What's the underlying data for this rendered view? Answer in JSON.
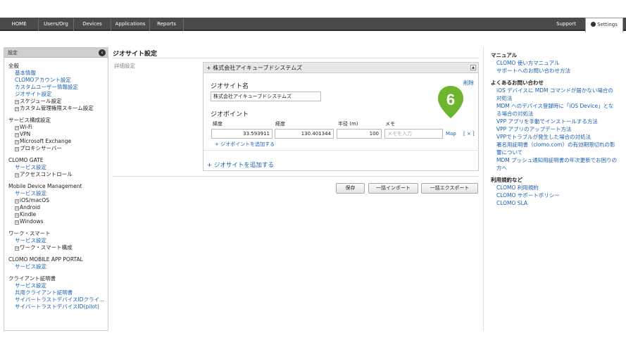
{
  "nav": {
    "items": [
      "HOME",
      "Users/Org",
      "Devices",
      "Applications",
      "Reports"
    ],
    "support": "Support",
    "settings": "Settings"
  },
  "sidebar": {
    "header": "設定",
    "collapse_symbol": "‹",
    "sections": [
      {
        "title": "全般",
        "items": [
          {
            "label": "基本情報",
            "kind": "link"
          },
          {
            "label": "CLOMOアカウント設定",
            "kind": "link"
          },
          {
            "label": "カスタムユーザー情報設定",
            "kind": "link"
          },
          {
            "label": "ジオサイト設定",
            "kind": "link"
          },
          {
            "label": "スケジュール設定",
            "kind": "sub"
          },
          {
            "label": "カスタム管理権限スキーム設定",
            "kind": "sub"
          }
        ]
      },
      {
        "title": "サービス構成設定",
        "items": [
          {
            "label": "Wi-Fi",
            "kind": "sub"
          },
          {
            "label": "VPN",
            "kind": "sub"
          },
          {
            "label": "Microsoft Exchange",
            "kind": "sub"
          },
          {
            "label": "プロキシサーバー",
            "kind": "sub"
          }
        ]
      },
      {
        "title": "CLOMO GATE",
        "items": [
          {
            "label": "サービス設定",
            "kind": "link"
          },
          {
            "label": "アクセスコントロール",
            "kind": "sub"
          }
        ]
      },
      {
        "title": "Mobile Device Management",
        "items": [
          {
            "label": "サービス設定",
            "kind": "link"
          },
          {
            "label": "iOS/macOS",
            "kind": "sub"
          },
          {
            "label": "Android",
            "kind": "sub"
          },
          {
            "label": "Kindle",
            "kind": "sub"
          },
          {
            "label": "Windows",
            "kind": "sub"
          }
        ]
      },
      {
        "title": "ワーク・スマート",
        "items": [
          {
            "label": "サービス設定",
            "kind": "link"
          },
          {
            "label": "ワーク・スマート構成",
            "kind": "sub"
          }
        ]
      },
      {
        "title": "CLOMO MOBILE APP PORTAL",
        "items": [
          {
            "label": "サービス設定",
            "kind": "link"
          }
        ]
      },
      {
        "title": "クライアント証明書",
        "items": [
          {
            "label": "サービス設定",
            "kind": "link"
          },
          {
            "label": "共用クライアント証明書",
            "kind": "link"
          },
          {
            "label": "サイバートラストデバイスIDクライ...",
            "kind": "link"
          },
          {
            "label": "サイバートラストデバイスID(pilot)",
            "kind": "link"
          }
        ]
      }
    ]
  },
  "main": {
    "page_title": "ジオサイト設定",
    "detail_label": "詳細設定",
    "panel_title": "+ 株式会社アイキューブドシステムズ",
    "panel_collapse": "▲",
    "delete_label": "削除",
    "site_name_title": "ジオサイト名",
    "site_name_value": "株式会社アイキューブドシステムズ",
    "geo_point_title": "ジオポイント",
    "columns": {
      "lat": "緯度",
      "lng": "経度",
      "radius": "半径 (m)",
      "memo": "メモ"
    },
    "point": {
      "lat": "33.593911",
      "lng": "130.401344",
      "radius": "100",
      "memo_placeholder": "メモを入力"
    },
    "map_label": "Map",
    "remove_point": "[ × ]",
    "add_point": "+ ジオポイントを追加する",
    "add_site": "+ ジオサイトを追加する",
    "marker_number": "6",
    "buttons": {
      "save": "保存",
      "import": "一括インポート",
      "export": "一括エクスポート"
    }
  },
  "right": {
    "manual_title": "マニュアル",
    "manual_links": [
      "CLOMO 使い方マニュアル",
      "サポートへのお問い合わせ方法"
    ],
    "faq_title": "よくあるお問い合わせ",
    "faq_links": [
      "iOS デバイスに MDM コマンドが届かない場合の対処法",
      "MDM へのデバイス登録時に「iOS Device」となる場合の対処法",
      "VPP アプリを手動でインストールする方法",
      "VPP アプリのアップデート方法",
      "VPPでトラブルが発生した場合の対処法",
      "署名用証明書（clomo.com）の有効期限切れの影響について",
      "MDM プッシュ通知用証明書の年次更新でお困りの方へ"
    ],
    "terms_title": "利用規約など",
    "terms_links": [
      "CLOMO 利用規約",
      "CLOMO サポートポリシー",
      "CLOMO SLA"
    ]
  },
  "colors": {
    "accent_green": "#6cb52d",
    "link": "#1a5fb4",
    "nav_bg": "#4a4a4a"
  }
}
